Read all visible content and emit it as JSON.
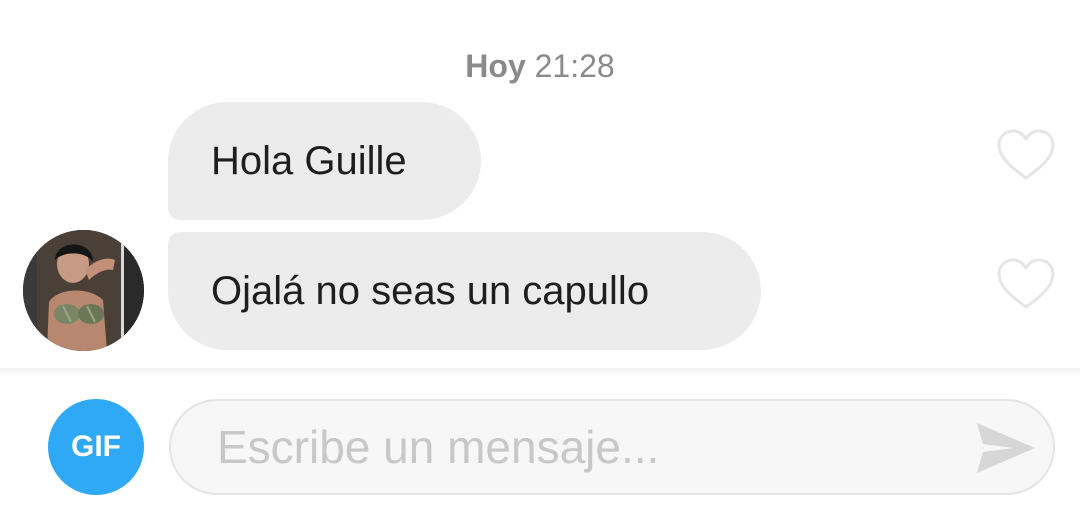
{
  "chat": {
    "timestamp": {
      "day": "Hoy",
      "time": "21:28"
    },
    "messages": [
      {
        "text": "Hola Guille",
        "liked": false
      },
      {
        "text": "Ojalá no seas un capullo",
        "liked": false
      }
    ]
  },
  "composer": {
    "gif_label": "GIF",
    "placeholder": "Escribe un mensaje...",
    "value": ""
  },
  "icons": {
    "like": "heart-outline-icon",
    "send": "send-arrow-icon"
  },
  "colors": {
    "bubble": "#ececec",
    "gif_button": "#2fa8f5",
    "timestamp": "#8a8a8a",
    "placeholder": "#c8c8c8"
  }
}
